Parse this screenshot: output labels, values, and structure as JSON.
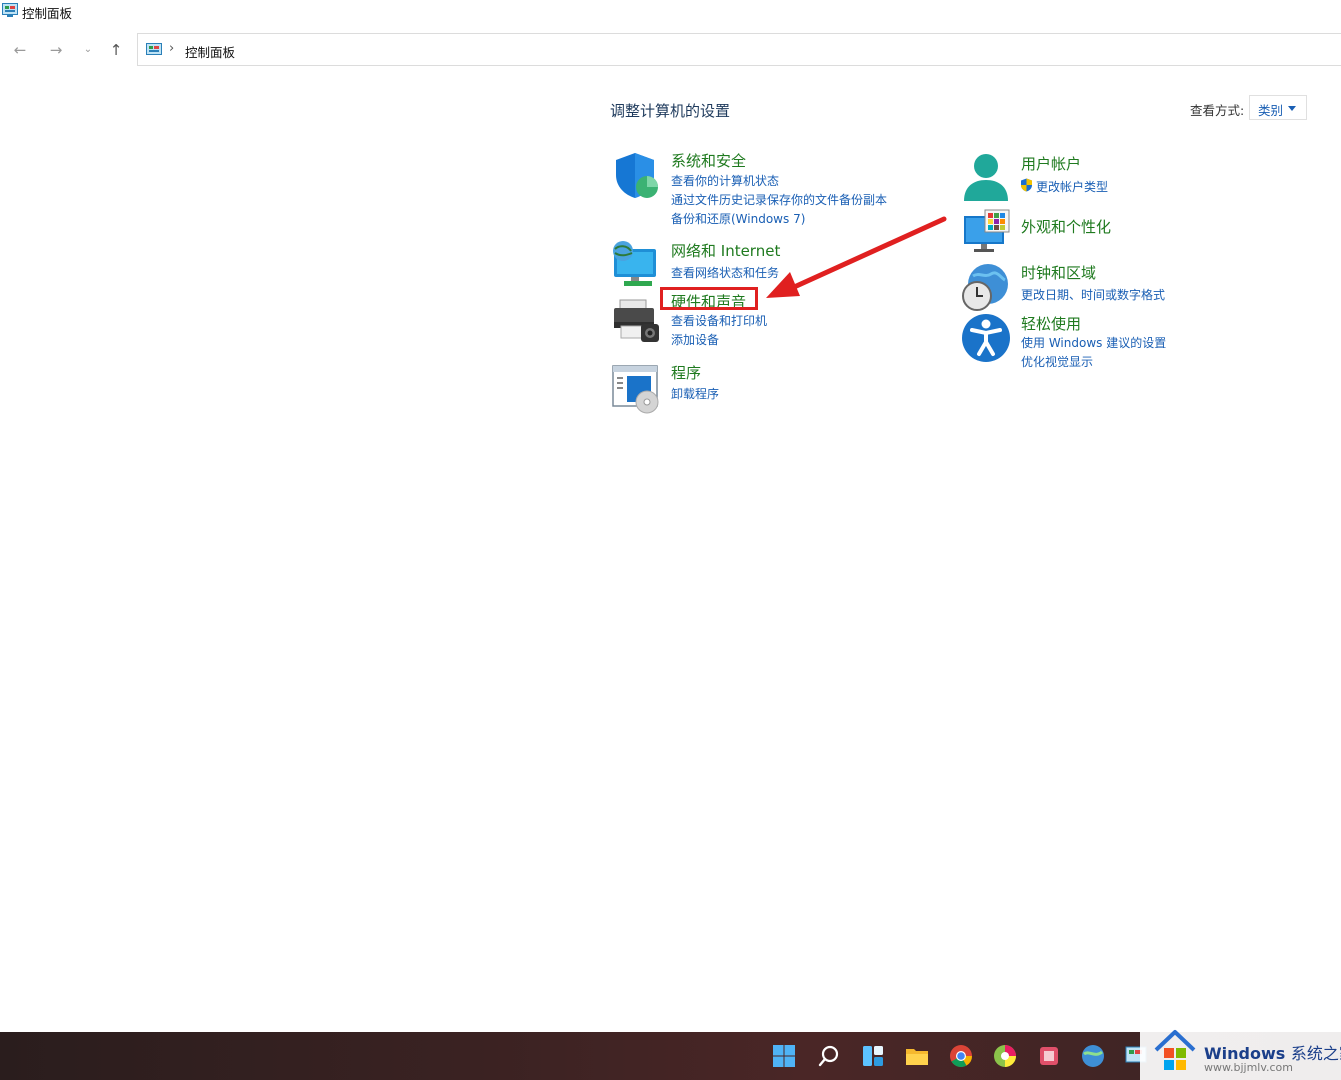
{
  "window": {
    "title": "控制面板"
  },
  "address": {
    "path": "控制面板",
    "separator": "›"
  },
  "header": {
    "heading": "调整计算机的设置",
    "viewby_label": "查看方式:",
    "viewby_value": "类别"
  },
  "categories": {
    "system": {
      "title": "系统和安全",
      "links": [
        "查看你的计算机状态",
        "通过文件历史记录保存你的文件备份副本",
        "备份和还原(Windows 7)"
      ]
    },
    "network": {
      "title": "网络和 Internet",
      "links": [
        "查看网络状态和任务"
      ]
    },
    "hardware": {
      "title": "硬件和声音",
      "links": [
        "查看设备和打印机",
        "添加设备"
      ]
    },
    "programs": {
      "title": "程序",
      "links": [
        "卸载程序"
      ]
    },
    "users": {
      "title": "用户帐户",
      "links": [
        "更改帐户类型"
      ]
    },
    "appearance": {
      "title": "外观和个性化",
      "links": []
    },
    "clock": {
      "title": "时钟和区域",
      "links": [
        "更改日期、时间或数字格式"
      ]
    },
    "ease": {
      "title": "轻松使用",
      "links": [
        "使用 Windows 建议的设置",
        "优化视觉显示"
      ]
    }
  },
  "annotation": {
    "color": "#e02020"
  },
  "taskbar": {
    "icons": [
      "windows-start-icon",
      "search-icon",
      "widgets-icon",
      "file-explorer-icon",
      "chrome-icon",
      "color-browser-icon",
      "app-icon",
      "globe-app-icon",
      "control-panel-icon"
    ]
  },
  "watermark": {
    "brand": "Windows",
    "brand_cn": "系统之家",
    "url": "www.bjjmlv.com"
  }
}
